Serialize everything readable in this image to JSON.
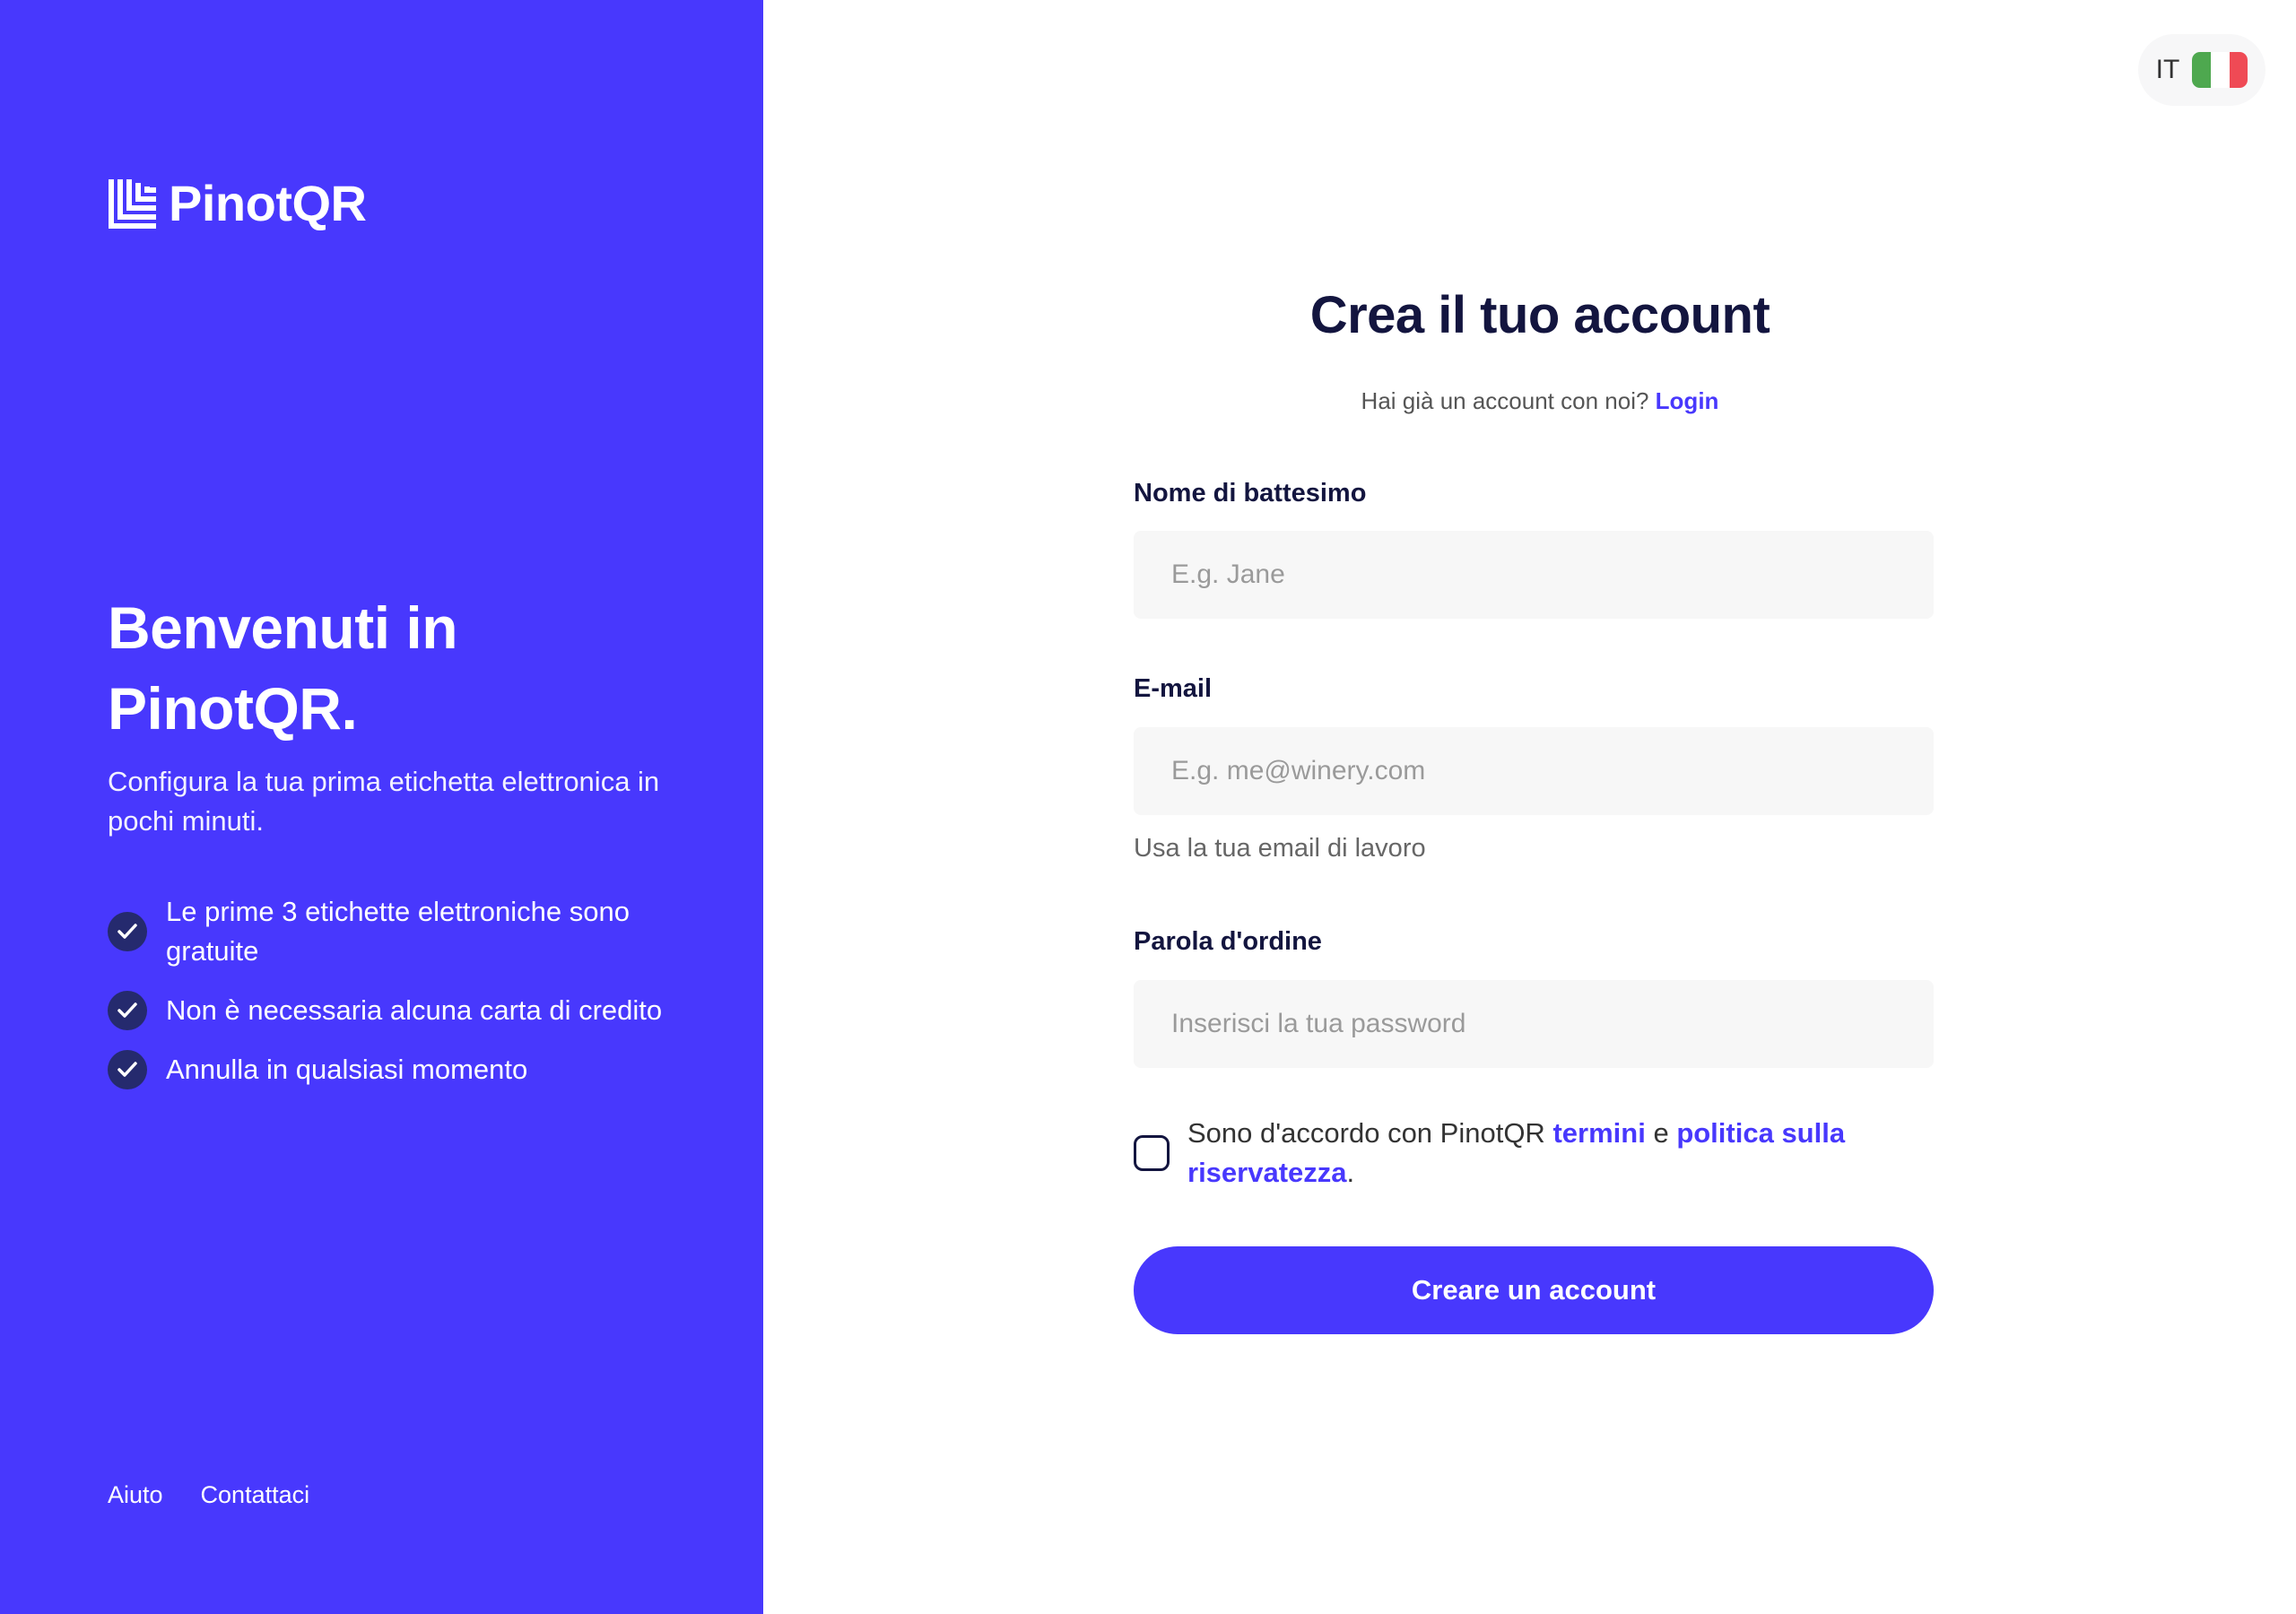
{
  "brand": {
    "name": "PinotQR",
    "color": "#4838fd"
  },
  "left": {
    "headline": "Benvenuti in PinotQR.",
    "subline": "Configura la tua prima etichetta elettronica in pochi minuti.",
    "features": [
      "Le prime 3 etichette elettroniche sono gratuite",
      "Non è necessaria alcuna carta di credito",
      "Annulla in qualsiasi momento"
    ],
    "footer": {
      "help": "Aiuto",
      "contact": "Contattaci"
    }
  },
  "language": {
    "code": "IT",
    "flag_icon": "italy-flag-icon",
    "flag_colors": [
      "#4ea84f",
      "#ffffff",
      "#ef4a55"
    ]
  },
  "form": {
    "title": "Crea il tuo account",
    "login_prompt": "Hai già un account con noi?",
    "login_link": "Login",
    "first_name": {
      "label": "Nome di battesimo",
      "placeholder": "E.g. Jane",
      "value": ""
    },
    "email": {
      "label": "E-mail",
      "placeholder": "E.g. me@winery.com",
      "value": "",
      "hint": "Usa la tua email di lavoro"
    },
    "password": {
      "label": "Parola d'ordine",
      "placeholder": "Inserisci la tua password",
      "value": ""
    },
    "agree": {
      "prefix": "Sono d'accordo con PinotQR",
      "terms": "termini",
      "and": "e",
      "privacy": "politica sulla riservatezza",
      "suffix": ".",
      "checked": false
    },
    "submit": "Creare un account"
  }
}
